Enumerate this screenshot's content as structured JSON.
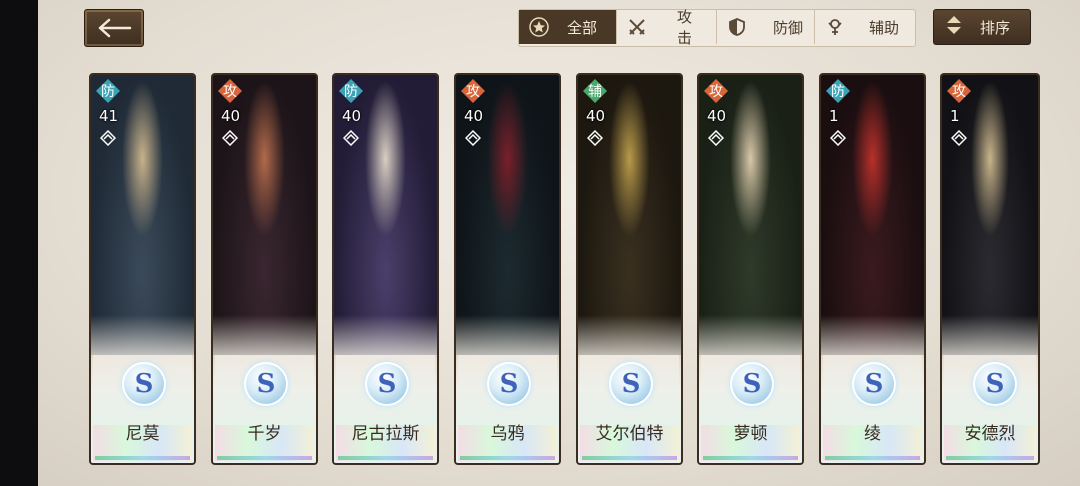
{
  "header": {
    "filters": [
      {
        "label": "全部",
        "icon": "star-badge-icon",
        "active": true
      },
      {
        "label": "攻击",
        "icon": "crossed-swords-icon",
        "active": false
      },
      {
        "label": "防御",
        "icon": "shield-icon",
        "active": false
      },
      {
        "label": "辅助",
        "icon": "support-icon",
        "active": false
      }
    ],
    "sort_label": "排序"
  },
  "cards": [
    {
      "name": "尼莫",
      "role": "防",
      "level": "41",
      "rarity": "S",
      "role_color": "#3aa3b6",
      "art_colors": [
        "#3b4a5a",
        "#1f2a36",
        "#c8b28a"
      ]
    },
    {
      "name": "千岁",
      "role": "攻",
      "level": "40",
      "rarity": "S",
      "role_color": "#d9663a",
      "art_colors": [
        "#3a2630",
        "#1c1418",
        "#b26a4a"
      ]
    },
    {
      "name": "尼古拉斯",
      "role": "防",
      "level": "40",
      "rarity": "S",
      "role_color": "#3aa3b6",
      "art_colors": [
        "#4a3f6a",
        "#221c36",
        "#d8d0c0"
      ]
    },
    {
      "name": "乌鸦",
      "role": "攻",
      "level": "40",
      "rarity": "S",
      "role_color": "#d9663a",
      "art_colors": [
        "#1c2a30",
        "#0e1418",
        "#7a1f2a"
      ]
    },
    {
      "name": "艾尔伯特",
      "role": "辅",
      "level": "40",
      "rarity": "S",
      "role_color": "#4aa86a",
      "art_colors": [
        "#3a3020",
        "#1c170f",
        "#b89a4a"
      ]
    },
    {
      "name": "萝顿",
      "role": "攻",
      "level": "40",
      "rarity": "S",
      "role_color": "#d9663a",
      "art_colors": [
        "#2e3a2a",
        "#1a2016",
        "#d8c8a8"
      ]
    },
    {
      "name": "绫",
      "role": "防",
      "level": "1",
      "rarity": "S",
      "role_color": "#3aa3b6",
      "art_colors": [
        "#3a1a1e",
        "#1a0e10",
        "#b8302a"
      ]
    },
    {
      "name": "安德烈",
      "role": "攻",
      "level": "1",
      "rarity": "S",
      "role_color": "#d9663a",
      "art_colors": [
        "#2a2a30",
        "#121216",
        "#c8b48a"
      ]
    }
  ]
}
